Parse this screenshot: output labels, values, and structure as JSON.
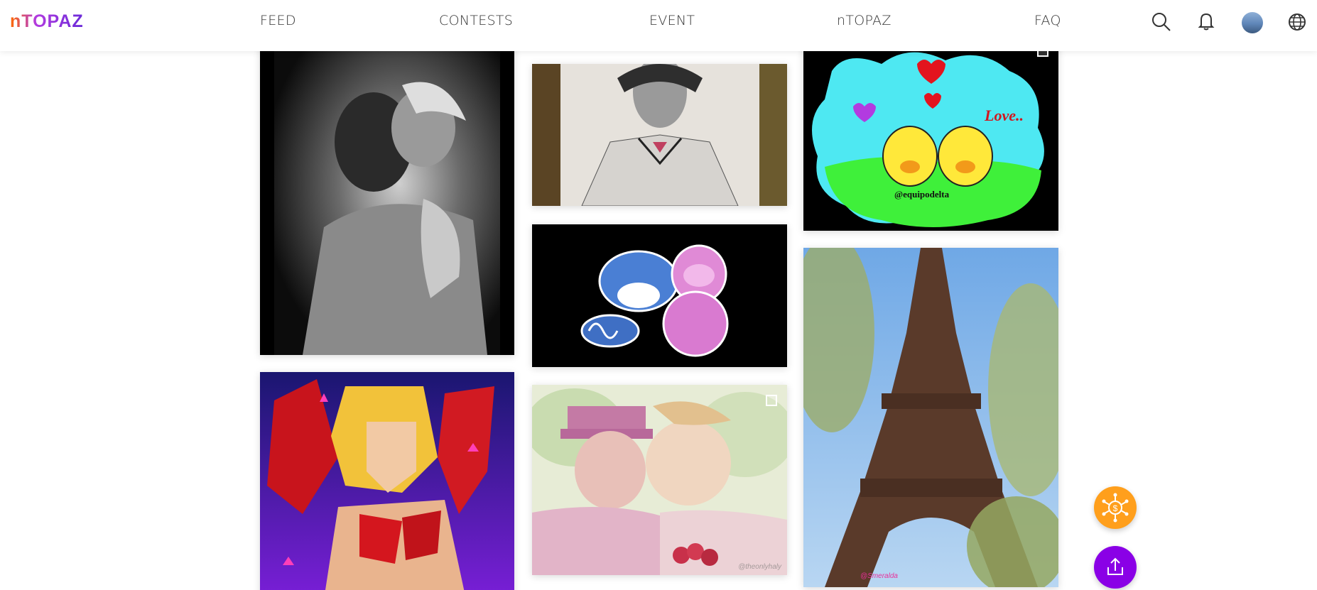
{
  "brand": {
    "logo_text": "nTOPAZ",
    "accent": "#7b2fd6",
    "orange": "#ff9f1c",
    "purple": "#8a00e6"
  },
  "nav": {
    "items": [
      {
        "label": "FEED"
      },
      {
        "label": "CONTESTS"
      },
      {
        "label": "EVENT"
      },
      {
        "label": "nTOPAZ"
      },
      {
        "label": "FAQ"
      }
    ]
  },
  "header_icons": [
    "search-icon",
    "bell-icon",
    "avatar",
    "globe-icon"
  ],
  "feed": {
    "tiles": [
      {
        "name": "photo-bw-couple-kiss",
        "multi": false,
        "watermark": ""
      },
      {
        "name": "drawing-man-portrait",
        "multi": false,
        "watermark": ""
      },
      {
        "name": "illustration-ducks-love",
        "multi": true,
        "text": "Love..",
        "handle": "@equipodelta"
      },
      {
        "name": "illustration-panda-sloth",
        "multi": false,
        "watermark": ""
      },
      {
        "name": "photo-eiffel-tower",
        "multi": false,
        "watermark": "@Smeralda"
      },
      {
        "name": "art-lowpoly-woman",
        "multi": false,
        "watermark": ""
      },
      {
        "name": "watercolor-old-couple",
        "multi": true,
        "watermark": "@theonlyhaly"
      }
    ]
  },
  "fabs": [
    "exchange-button",
    "upload-button"
  ]
}
